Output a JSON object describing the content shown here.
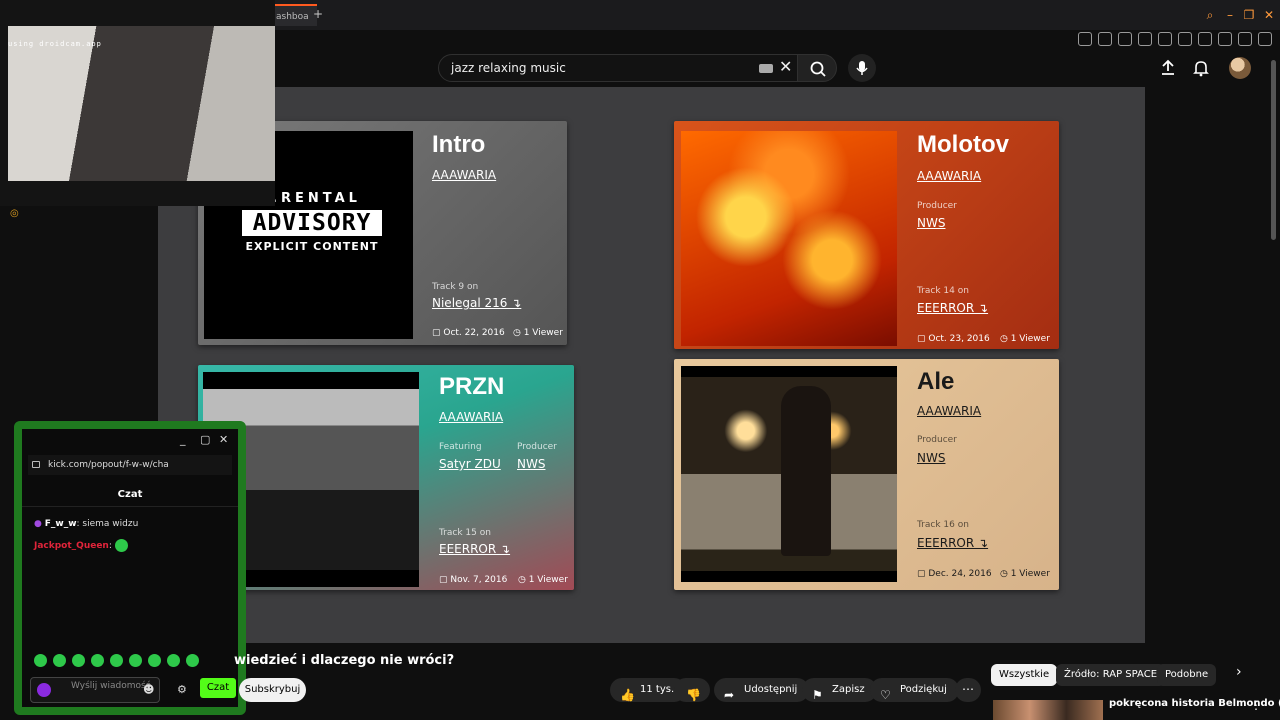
{
  "browser": {
    "tab_label": "ashboa",
    "tab_plus": "+"
  },
  "search": {
    "query": "jazz relaxing music"
  },
  "cards": {
    "intro": {
      "title": "Intro",
      "artist": "AAAWARIA",
      "advisory_top": "..RENTAL",
      "advisory_mid": "ADVISORY",
      "advisory_bot": "EXPLICIT CONTENT",
      "track_label": "Track 9 on",
      "album": "Nielegal 216 ↴",
      "date": "Oct. 22, 2016",
      "viewers": "1 Viewer"
    },
    "molotov": {
      "title": "Molotov",
      "artist": "AAAWARIA",
      "producer_label": "Producer",
      "producer": "NWS",
      "track_label": "Track 14 on",
      "album": "EEERROR ↴",
      "date": "Oct. 23, 2016",
      "viewers": "1 Viewer"
    },
    "przn": {
      "title": "PRZN",
      "artist": "AAAWARIA",
      "featuring_label": "Featuring",
      "featuring": "Satyr ZDU",
      "producer_label": "Producer",
      "producer": "NWS",
      "track_label": "Track 15 on",
      "album": "EEERROR ↴",
      "date": "Nov. 7, 2016",
      "viewers": "1 Viewer"
    },
    "ale": {
      "title": "Ale",
      "artist": "AAAWARIA",
      "producer_label": "Producer",
      "producer": "NWS",
      "track_label": "Track 16 on",
      "album": "EEERROR ↴",
      "date": "Dec. 24, 2016",
      "viewers": "1 Viewer"
    }
  },
  "webcam": {
    "label": "using droidcam.app"
  },
  "kick": {
    "url": "kick.com/popout/f-w-w/cha",
    "title": "Czat",
    "messages": [
      {
        "user": "F_w_w",
        "text": "siema widzu"
      },
      {
        "user": "Jackpot_Queen",
        "text": ""
      }
    ],
    "input_placeholder": "Wyślij wiadomość",
    "send_label": "Czat"
  },
  "video": {
    "title": "wiedzieć i dlaczego nie wróci?",
    "subscribe": "Subskrybuj",
    "likes": "11 tys.",
    "share": "Udostępnij",
    "save": "Zapisz",
    "thanks": "Podziękuj",
    "more": "⋯"
  },
  "chips": [
    "Wszystkie",
    "Źródło: RAP SPACE",
    "Podobne"
  ],
  "related": {
    "title": "pokręcona historia Belmondo (i"
  },
  "colors": {
    "kick_green": "#53fc18",
    "accent_orange": "#ff5a1f"
  }
}
